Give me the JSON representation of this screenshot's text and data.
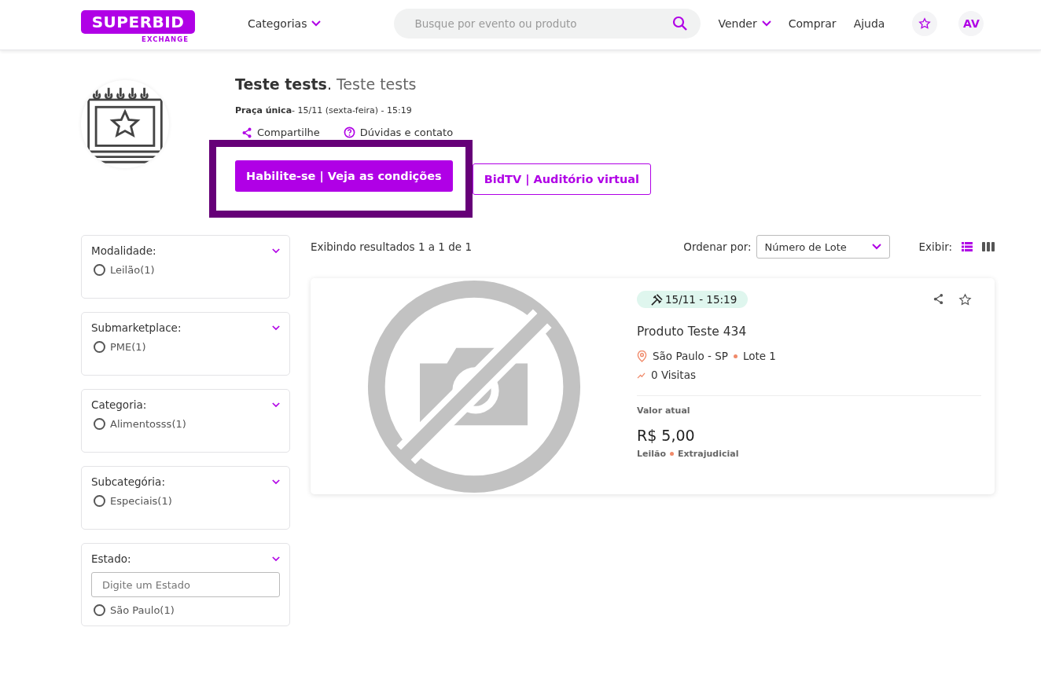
{
  "header": {
    "logo": "SUPERBID",
    "logo_sub": "EXCHANGE",
    "nav_categories": "Categorias",
    "search": {
      "placeholder": "Busque por evento ou produto"
    },
    "links": [
      {
        "label": "Vender",
        "dropdown": true
      },
      {
        "label": "Comprar",
        "dropdown": false
      },
      {
        "label": "Ajuda",
        "dropdown": false
      }
    ],
    "avatar": "AV"
  },
  "event": {
    "title": "**Teste tests**.",
    "subtitle": "Teste tests",
    "schedule": "**Praça única**- 15/11 (sexta-feira) - 15:19",
    "share": "Compartilhe",
    "contact": "Dúvidas e contato",
    "primary_button": "Habilite-se | Veja as condições",
    "secondary_button": "BidTV | Auditório virtual",
    "highlighted": true
  },
  "filters": [
    {
      "title": "Modalidade:",
      "options": [
        {
          "label": "Leilão(1)",
          "selected": false
        }
      ]
    },
    {
      "title": "Submarketplace:",
      "options": [
        {
          "label": "PME(1)",
          "selected": false
        }
      ]
    },
    {
      "title": "Categoria:",
      "options": [
        {
          "label": "Alimentosss(1)",
          "selected": false
        }
      ]
    },
    {
      "title": "Subcategória:",
      "options": [
        {
          "label": "Especiais(1)",
          "selected": false
        }
      ]
    },
    {
      "title": "Estado:",
      "search_placeholder": "Digite um Estado",
      "options": [
        {
          "label": "São Paulo(1)",
          "selected": false
        }
      ]
    }
  ],
  "results": {
    "summary": "Exibindo resultados 1 a 1 de 1",
    "sort_label": "Ordenar por:",
    "sort_value": "Número de Lote",
    "view_label": "Exibir:",
    "views": [
      {
        "kind": "list",
        "selected": true
      },
      {
        "kind": "columns",
        "selected": false
      }
    ]
  },
  "lots": [
    {
      "date": "15/11 - 15:19",
      "title": "Produto Teste 434",
      "location": "São Paulo - SP",
      "lot": "Lote 1",
      "visits": "0 Visitas",
      "price_label": "Valor atual",
      "price": "R$ 5,00",
      "modality": "Leilão",
      "type": "Extrajudicial",
      "favorite": false
    }
  ]
}
